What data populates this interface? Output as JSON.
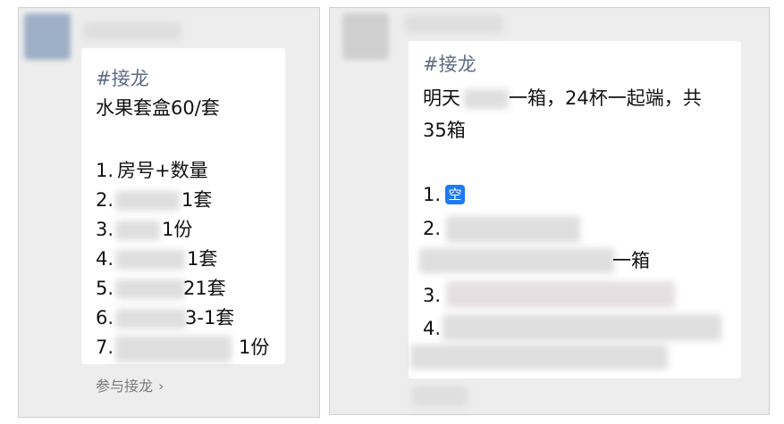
{
  "left_message": {
    "hashtag": "#接龙",
    "title": "水果套盒60/套",
    "entries": [
      {
        "number": "1.",
        "text": "房号+数量"
      },
      {
        "number": "2.",
        "text": "1套"
      },
      {
        "number": "3.",
        "text": "1份"
      },
      {
        "number": "4.",
        "text": "1套"
      },
      {
        "number": "5.",
        "text": "21套"
      },
      {
        "number": "6.",
        "text": "3-1套"
      },
      {
        "number": "7.",
        "text": "1份"
      }
    ],
    "join_label": "参与接龙",
    "join_chevron": "›"
  },
  "right_message": {
    "hashtag": "#接龙",
    "line1_before": "明天",
    "line1_after": "一箱，24杯一起端，共",
    "line2": "35箱",
    "entries": [
      {
        "number": "1.",
        "icon_text": "空",
        "icon": "kong-emoji-icon"
      },
      {
        "number": "2.",
        "trailing": "一箱"
      },
      {
        "number": "3."
      },
      {
        "number": "4."
      }
    ]
  },
  "colors": {
    "emoji_blue": "#1e7bf0",
    "panel_bg": "#ededed",
    "bubble_bg": "#ffffff",
    "hashtag": "#5d6b86"
  }
}
